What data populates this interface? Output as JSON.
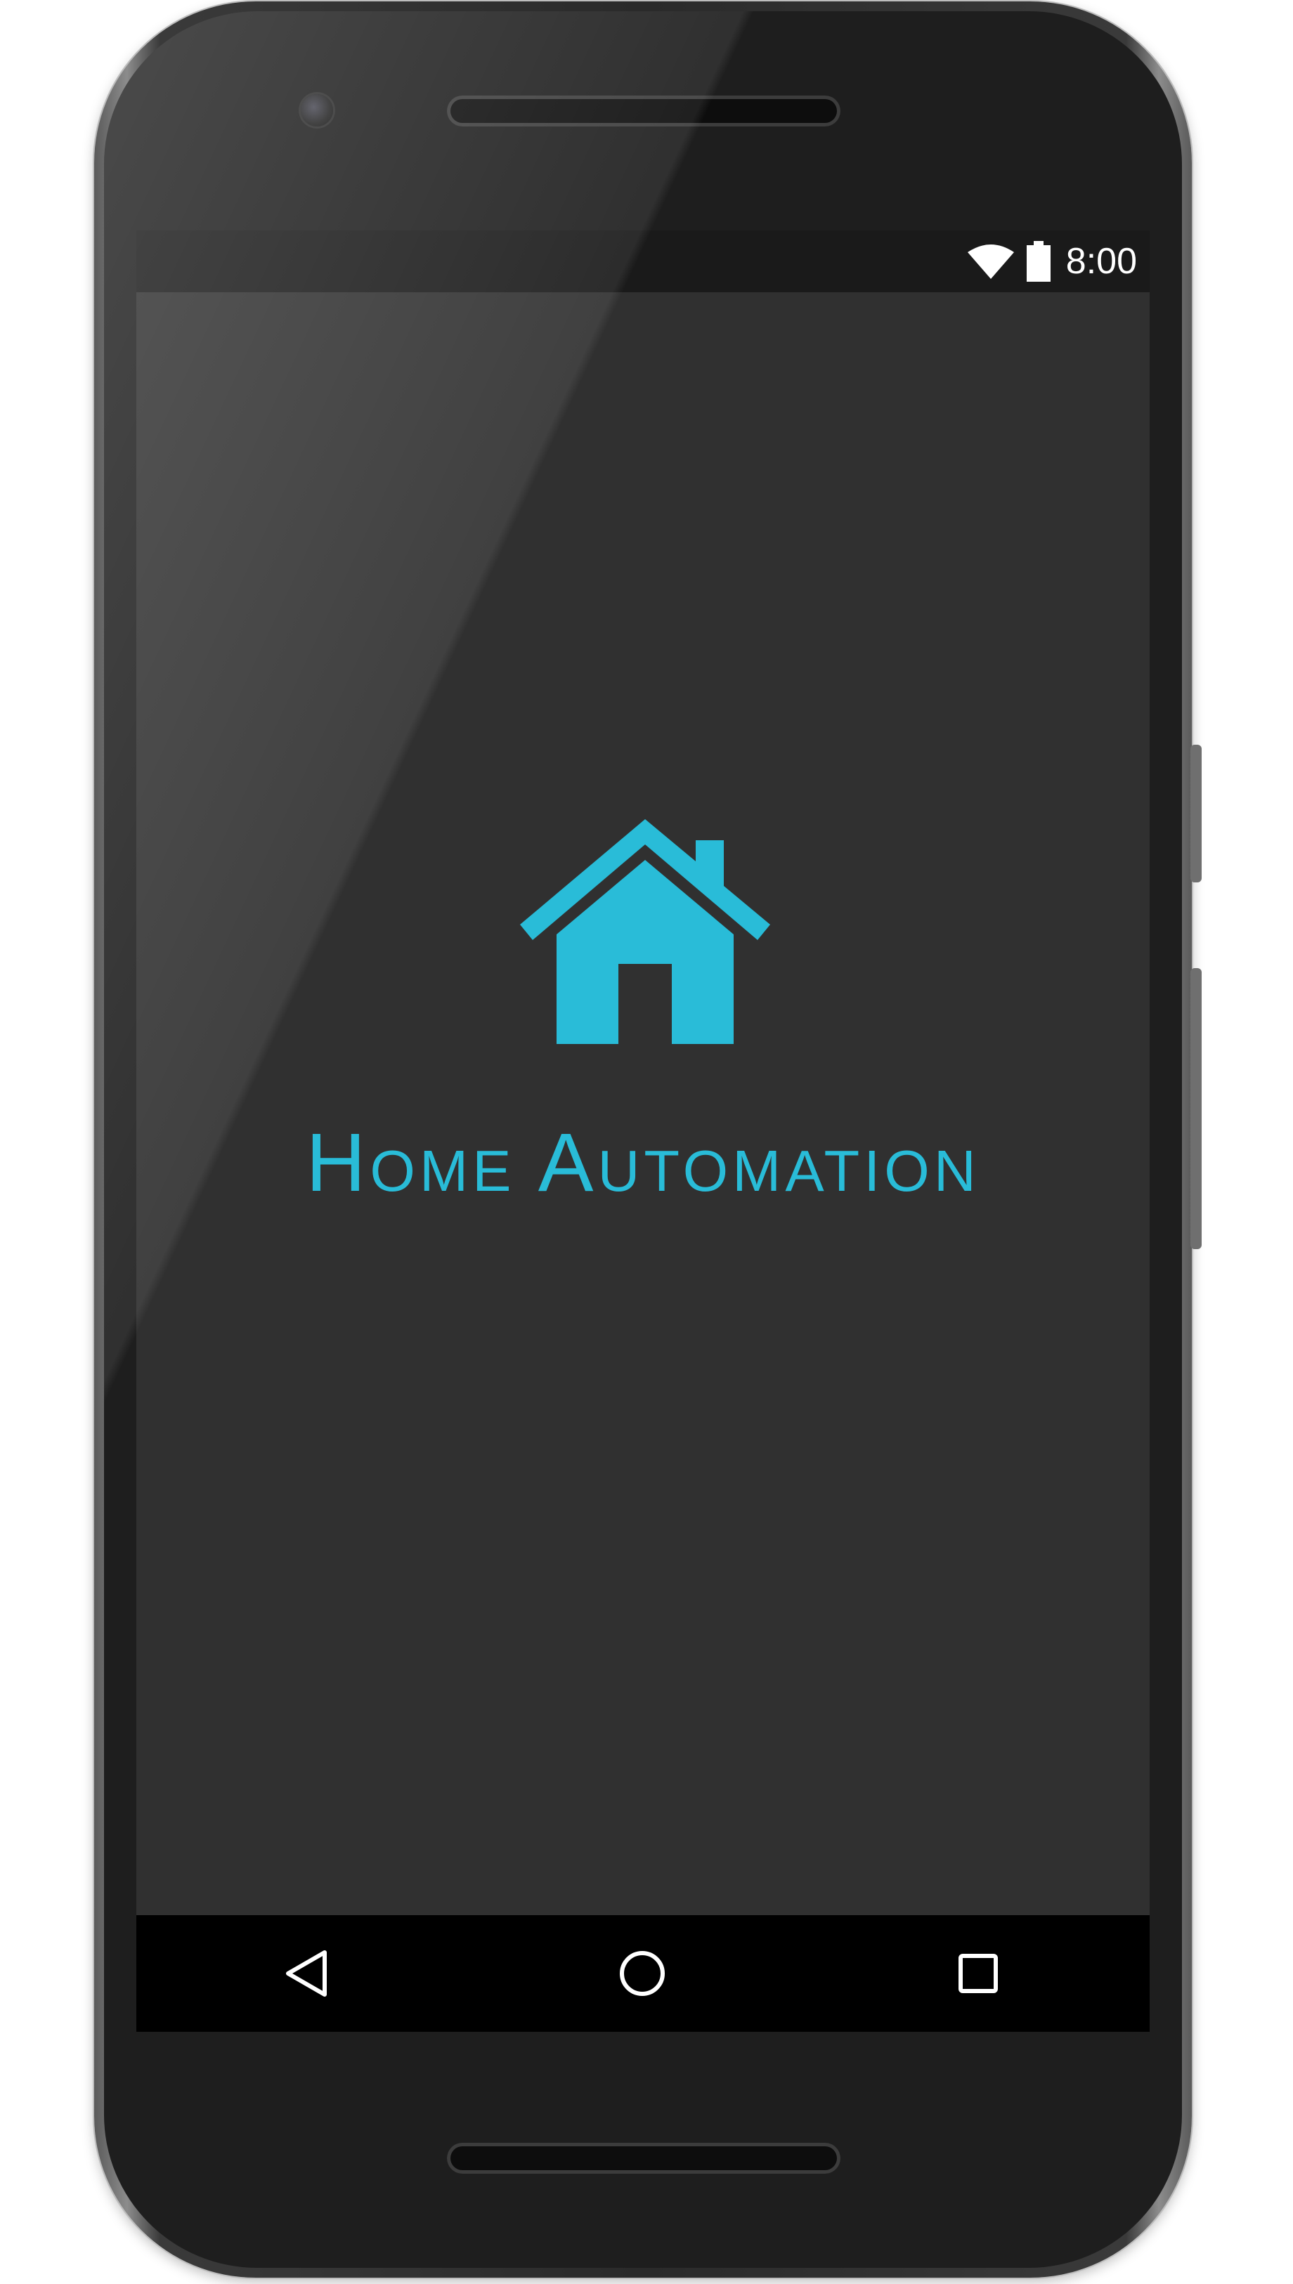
{
  "status_bar": {
    "time": "8:00",
    "icons": [
      "wifi-icon",
      "battery-icon"
    ]
  },
  "app": {
    "title": "Home Automation",
    "logo_icon": "house-icon",
    "accent_color": "#29bcd8",
    "background_color": "#303030"
  },
  "nav_bar": {
    "buttons": [
      "back-icon",
      "home-circle-icon",
      "recents-square-icon"
    ]
  }
}
